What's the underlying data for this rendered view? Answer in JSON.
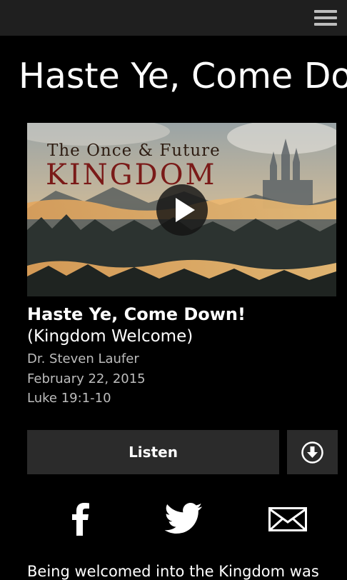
{
  "header": {
    "menu_icon": "hamburger-menu-icon"
  },
  "page": {
    "title": "Haste Ye, Come Down!"
  },
  "video": {
    "art_title_line1": "The Once & Future",
    "art_title_line2": "KINGDOM",
    "play_icon": "play-icon"
  },
  "sermon": {
    "title": "Haste Ye, Come Down!",
    "subtitle": "(Kingdom Welcome)",
    "speaker": "Dr. Steven Laufer",
    "date": "February 22, 2015",
    "scripture": "Luke 19:1-10"
  },
  "actions": {
    "listen_label": "Listen",
    "download_icon": "download-circle-icon"
  },
  "share": {
    "icons": [
      "facebook-icon",
      "twitter-icon",
      "email-icon"
    ]
  },
  "description": {
    "text": "Being welcomed into the Kingdom was"
  },
  "colors": {
    "background": "#000000",
    "topbar": "#1f1f1f",
    "button_bg": "#2b2b2b",
    "meta_text": "#bdbdbd"
  }
}
